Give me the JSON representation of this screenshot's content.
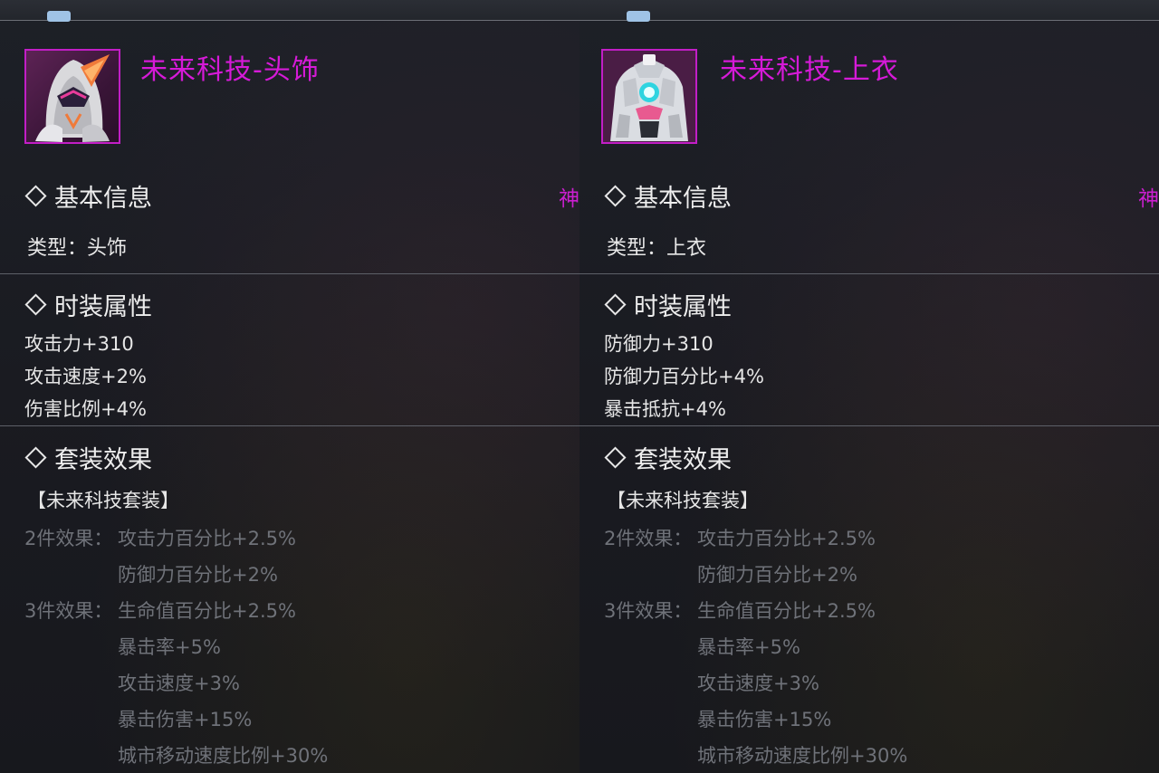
{
  "panels": [
    {
      "name": "未来科技-头饰",
      "rarity": "神",
      "basic_title": "基本信息",
      "type_line": "类型：头饰",
      "attr_title": "时装属性",
      "stats": [
        "攻击力+310",
        "攻击速度+2%",
        "伤害比例+4%"
      ],
      "set_title": "套装效果",
      "set_name": "【未来科技套装】",
      "set2_label": "2件效果：",
      "set2": [
        "攻击力百分比+2.5%",
        "防御力百分比+2%"
      ],
      "set3_label": "3件效果：",
      "set3": [
        "生命值百分比+2.5%",
        "暴击率+5%",
        "攻击速度+3%",
        "暴击伤害+15%",
        "城市移动速度比例+30%"
      ]
    },
    {
      "name": "未来科技-上衣",
      "rarity": "神",
      "basic_title": "基本信息",
      "type_line": "类型：上衣",
      "attr_title": "时装属性",
      "stats": [
        "防御力+310",
        "防御力百分比+4%",
        "暴击抵抗+4%"
      ],
      "set_title": "套装效果",
      "set_name": "【未来科技套装】",
      "set2_label": "2件效果：",
      "set2": [
        "攻击力百分比+2.5%",
        "防御力百分比+2%"
      ],
      "set3_label": "3件效果：",
      "set3": [
        "生命值百分比+2.5%",
        "暴击率+5%",
        "攻击速度+3%",
        "暴击伤害+15%",
        "城市移动速度比例+30%"
      ]
    }
  ],
  "colors": {
    "rarity_magenta": "#d61ad8",
    "text_main": "#e6e6e6",
    "text_dim": "#6f7279",
    "divider": "#5d6068"
  },
  "icons": [
    "helmet-item-icon",
    "armor-item-icon",
    "diamond-icon"
  ]
}
